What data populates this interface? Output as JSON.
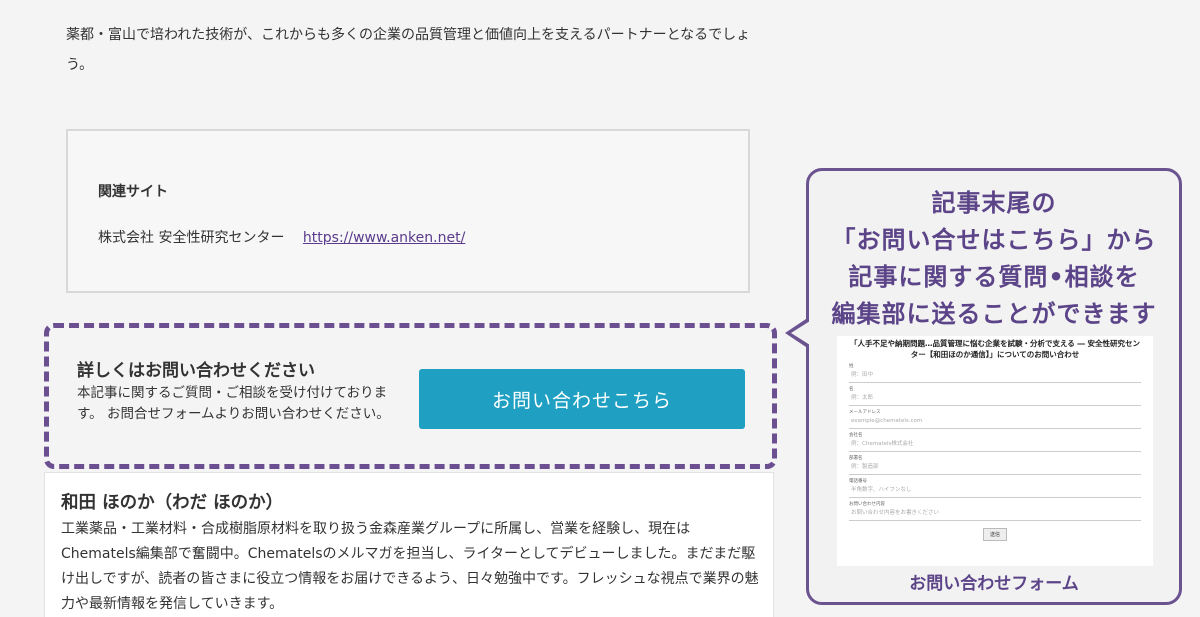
{
  "intro": {
    "text": "薬都・富山で培われた技術が、これからも多くの企業の品質管理と価値向上を支えるパートナーとなるでしょう。"
  },
  "related": {
    "heading": "関連サイト",
    "company": "株式会社 安全性研究センター",
    "url": "https://www.anken.net/"
  },
  "cta": {
    "heading": "詳しくはお問い合わせください",
    "body": "本記事に関するご質問・ご相談を受け付けております。 お問合せフォームよりお問い合わせください。",
    "button_label": "お問い合わせこちら"
  },
  "author": {
    "name": "和田 ほのか（わだ ほのか）",
    "bio": "工業薬品・工業材料・合成樹脂原材料を取り扱う金森産業グループに所属し、営業を経験し、現在はChematels編集部で奮闘中。Chematelsのメルマガを担当し、ライターとしてデビューしました。まだまだ駆け出しですが、読者の皆さまに役立つ情報をお届けできるよう、日々勉強中です。フレッシュな視点で業界の魅力や最新情報を発信していきます。"
  },
  "callout": {
    "lines": [
      "記事末尾の",
      "「お問い合せはこちら」から",
      "記事に関する質問•相談を",
      "編集部に送ることができます"
    ],
    "caption": "お問い合わせフォーム",
    "accent_color": "#5c4489"
  },
  "form": {
    "title": "「人手不足や納期問題…品質管理に悩む企業を試験・分析で支える ― 安全性研究センター【和田ほのか通信】」についてのお問い合わせ",
    "fields": [
      {
        "label": "姓",
        "placeholder": "例：田中"
      },
      {
        "label": "名",
        "placeholder": "例：太郎"
      },
      {
        "label": "メールアドレス",
        "placeholder": "example@chematels.com"
      },
      {
        "label": "会社名",
        "placeholder": "例：Chematels株式会社"
      },
      {
        "label": "部署名",
        "placeholder": "例：製造部"
      },
      {
        "label": "電話番号",
        "placeholder": "半角数字、ハイフンなし"
      },
      {
        "label": "お問い合わせ内容",
        "placeholder": "お問い合わせ内容をお書きください"
      }
    ],
    "submit_label": "送信"
  }
}
